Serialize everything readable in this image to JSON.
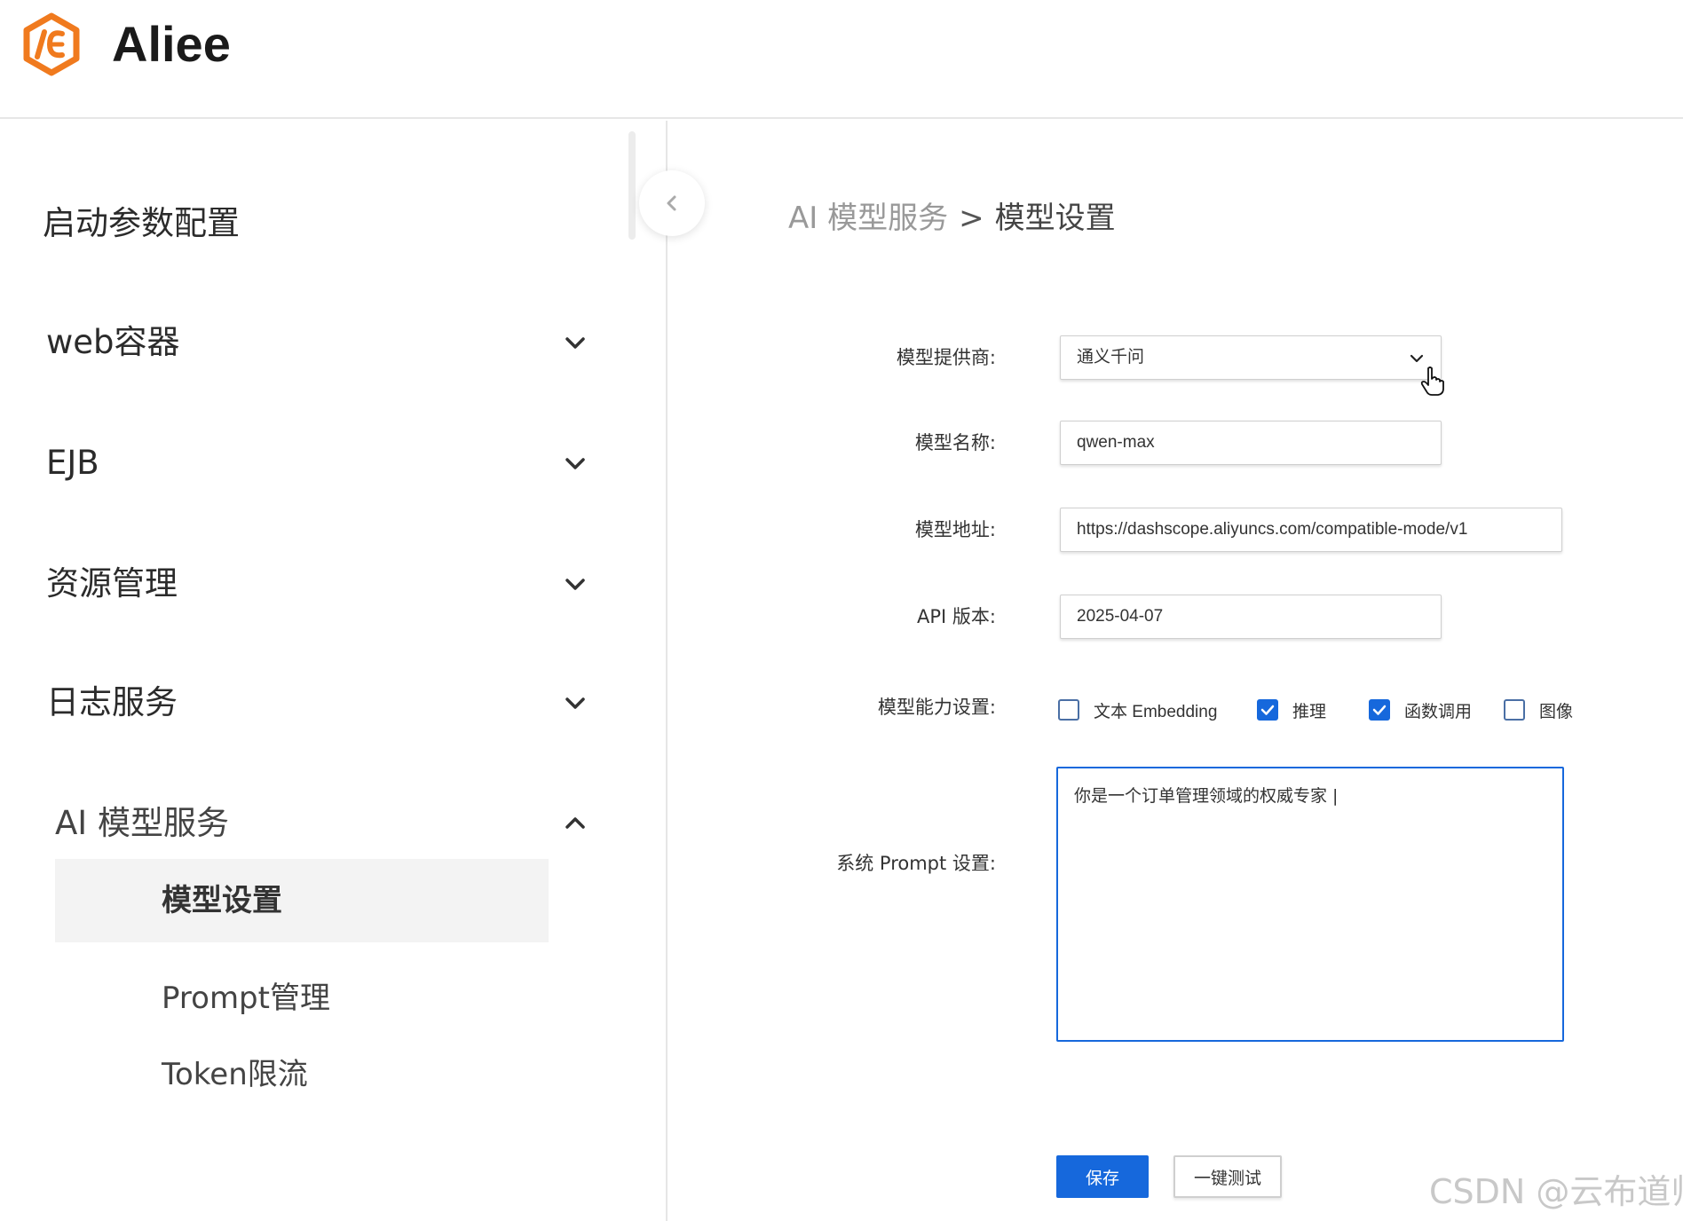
{
  "header": {
    "brand": "Aliee",
    "logo_icon": "aliee-hexagon-logo-icon",
    "brand_color": "#F07A1E"
  },
  "sidebar": {
    "top_item": {
      "label": "启动参数配置"
    },
    "groups": [
      {
        "label": "web容器",
        "state": "collapsed"
      },
      {
        "label": "EJB",
        "state": "collapsed"
      },
      {
        "label": "资源管理",
        "state": "collapsed"
      },
      {
        "label": "日志服务",
        "state": "collapsed"
      },
      {
        "label": "AI 模型服务",
        "state": "expanded"
      }
    ],
    "sub_items": [
      {
        "label": "模型设置",
        "active": true
      },
      {
        "label": "Prompt管理",
        "active": false
      },
      {
        "label": "Token限流",
        "active": false
      }
    ]
  },
  "breadcrumb": {
    "parent": "AI 模型服务",
    "separator": ">",
    "current": "模型设置"
  },
  "form": {
    "provider_label": "模型提供商:",
    "provider_value": "通义千问",
    "model_name_label": "模型名称:",
    "model_name_value": "qwen-max",
    "model_url_label": "模型地址:",
    "model_url_value": "https://dashscope.aliyuncs.com/compatible-mode/v1",
    "api_version_label": "API 版本:",
    "api_version_value": "2025-04-07",
    "capabilities_label": "模型能力设置:",
    "capabilities": [
      {
        "label": "文本 Embedding",
        "checked": false
      },
      {
        "label": "推理",
        "checked": true
      },
      {
        "label": "函数调用",
        "checked": true
      },
      {
        "label": "图像",
        "checked": false
      }
    ],
    "prompt_label": "系统 Prompt 设置:",
    "prompt_value": "你是一个订单管理领域的权威专家 |"
  },
  "actions": {
    "save_label": "保存",
    "test_label": "一键测试"
  },
  "watermark": "CSDN @云布道师",
  "colors": {
    "primary": "#1668DC",
    "active_bg": "#F3F3F3"
  }
}
